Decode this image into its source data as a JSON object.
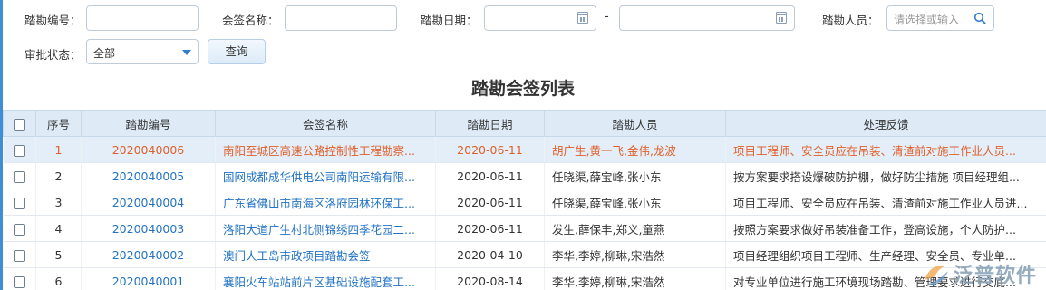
{
  "filters": {
    "code_label": "踏勘编号：",
    "name_label": "会签名称：",
    "date_label": "踏勘日期：",
    "date_separator": "-",
    "person_label": "踏勘人员：",
    "person_placeholder": "请选择或输入",
    "status_label": "审批状态：",
    "status_value": "全部",
    "query_button": "查询"
  },
  "list": {
    "title": "踏勘会签列表",
    "columns": [
      "序号",
      "踏勘编号",
      "会签名称",
      "踏勘日期",
      "踏勘人员",
      "处理反馈"
    ],
    "rows": [
      {
        "no": "1",
        "code": "2020040006",
        "name": "南阳至城区高速公路控制性工程勘察...",
        "date": "2020-06-11",
        "persons": "胡广生,黄一飞,金伟,龙波",
        "feedback": "项目工程师、安全员应在吊装、清渣前对施工作业人员...",
        "selected": true
      },
      {
        "no": "2",
        "code": "2020040005",
        "name": "国网成都成华供电公司南阳运输有限...",
        "date": "2020-06-11",
        "persons": "任晓渠,薛宝峰,张小东",
        "feedback": "按方案要求搭设爆破防护棚，做好防尘措施 项目经理组...",
        "selected": false
      },
      {
        "no": "3",
        "code": "2020040004",
        "name": "广东省佛山市南海区洛府园林环保工...",
        "date": "2020-06-11",
        "persons": "任晓渠,薛宝峰,张小东",
        "feedback": "项目工程师、安全员应在吊装、清渣前对施工作业人员进...",
        "selected": false
      },
      {
        "no": "4",
        "code": "2020040003",
        "name": "洛阳大道广生村北侧锦绣四季花园二...",
        "date": "2020-06-11",
        "persons": "发生,薛保丰,郑义,童燕",
        "feedback": "按照方案要求做好吊装准备工作，登高设施，个人防护...",
        "selected": false
      },
      {
        "no": "5",
        "code": "2020040002",
        "name": "澳门人工岛市政项目踏勘会签",
        "date": "2020-04-10",
        "persons": "李华,李婷,柳琳,宋浩然",
        "feedback": "项目经理组织项目工程师、生产经理、安全员、专业单...",
        "selected": false
      },
      {
        "no": "6",
        "code": "2020040001",
        "name": "襄阳火车站站前片区基础设施配套工...",
        "date": "2020-08-14",
        "persons": "李华,李婷,柳琳,宋浩然",
        "feedback": "对专业单位进行施工环境现场踏勘、管理要求进行交底...",
        "selected": false
      }
    ]
  },
  "watermark": {
    "text": "泛普软件",
    "icon": "fanpu-logo-icon"
  },
  "colors": {
    "header_bg": "#deebf7",
    "selected_row_bg": "#e3eef9",
    "selected_text": "#e0602a",
    "link_blue": "#2273c5"
  }
}
